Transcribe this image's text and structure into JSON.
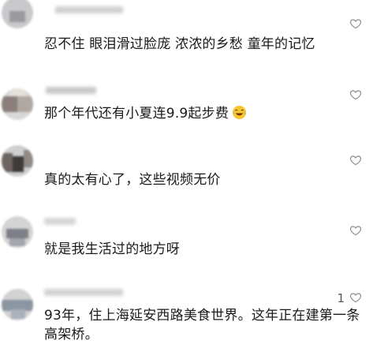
{
  "comments": [
    {
      "text": "忍不住 眼泪滑过脸庞 浓浓的乡愁 童年的记忆",
      "likes": ""
    },
    {
      "text": "那个年代还有小夏连9.9起步费",
      "likes": ""
    },
    {
      "text": "真的太有心了，这些视频无价",
      "likes": ""
    },
    {
      "text": "就是我生活过的地方呀",
      "likes": ""
    },
    {
      "text": "93年，住上海延安西路美食世界。这年正在建第一条高架桥。",
      "likes": "1"
    }
  ],
  "icons": {
    "like": "heart-outline-icon",
    "emoji": "laughing-tears-emoji"
  }
}
